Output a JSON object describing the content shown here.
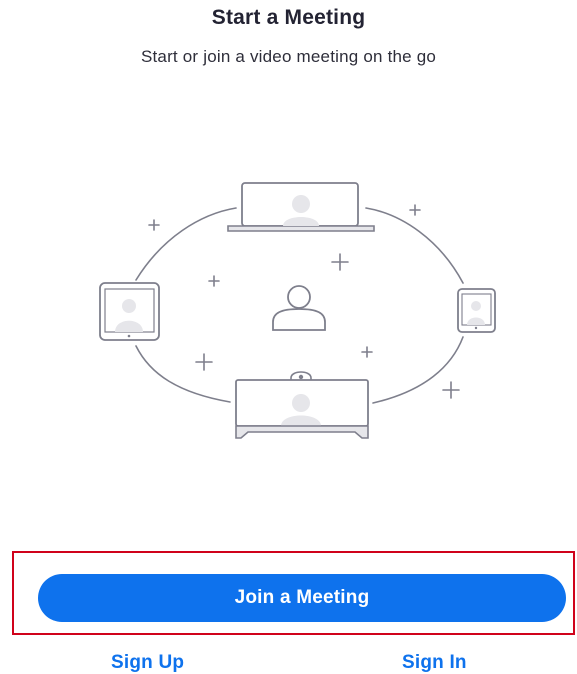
{
  "header": {
    "title": "Start a Meeting",
    "subtitle": "Start or join a video meeting on the go"
  },
  "illustration": {
    "devices": [
      "laptop-icon",
      "tablet-icon",
      "user-icon",
      "phone-icon",
      "desktop-monitor-icon"
    ],
    "decorations": [
      "plus-icon"
    ]
  },
  "actions": {
    "join_label": "Join a Meeting",
    "signup_label": "Sign Up",
    "signin_label": "Sign In"
  },
  "colors": {
    "accent": "#0e72ed",
    "highlight": "#d0021b",
    "illustration_stroke": "#7e7f8c",
    "illustration_fill": "#e6e6ea"
  }
}
